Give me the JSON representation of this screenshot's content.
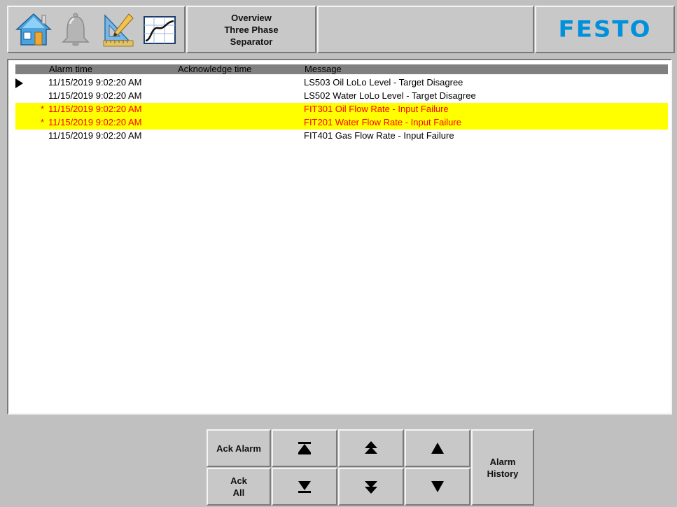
{
  "header": {
    "title": "Overview\nThree Phase\nSeparator",
    "logo": "FESTO",
    "icons": [
      "home-icon",
      "bell-icon",
      "drafting-tools-icon",
      "trend-chart-icon"
    ],
    "brand_color": "#0091dc"
  },
  "alarm_table": {
    "columns": [
      "Alarm time",
      "Acknowledge time",
      "Message"
    ],
    "rows": [
      {
        "prefix": "",
        "alarm_time": "11/15/2019 9:02:20 AM",
        "ack_time": "",
        "message": "LS503 Oil LoLo Level - Target Disagree",
        "selected": true,
        "unacknowledged": false
      },
      {
        "prefix": "",
        "alarm_time": "11/15/2019 9:02:20 AM",
        "ack_time": "",
        "message": "LS502 Water LoLo Level - Target Disagree",
        "selected": false,
        "unacknowledged": false
      },
      {
        "prefix": "*",
        "alarm_time": "11/15/2019 9:02:20 AM",
        "ack_time": "",
        "message": "FIT301 Oil Flow Rate - Input Failure",
        "selected": false,
        "unacknowledged": true
      },
      {
        "prefix": "*",
        "alarm_time": "11/15/2019 9:02:20 AM",
        "ack_time": "",
        "message": "FIT201 Water Flow Rate - Input Failure",
        "selected": false,
        "unacknowledged": true
      },
      {
        "prefix": "",
        "alarm_time": "11/15/2019 9:02:20 AM",
        "ack_time": "",
        "message": "FIT401 Gas Flow Rate - Input Failure",
        "selected": false,
        "unacknowledged": false
      }
    ],
    "alert_bg": "#ffff00",
    "alert_text": "#ff0000"
  },
  "buttons": {
    "ack_alarm": "Ack Alarm",
    "ack_all": "Ack\nAll",
    "alarm_history": "Alarm\nHistory",
    "scroll_top": "scroll-top-icon",
    "page_up": "page-up-icon",
    "line_up": "line-up-icon",
    "scroll_bottom": "scroll-bottom-icon",
    "page_down": "page-down-icon",
    "line_down": "line-down-icon"
  }
}
